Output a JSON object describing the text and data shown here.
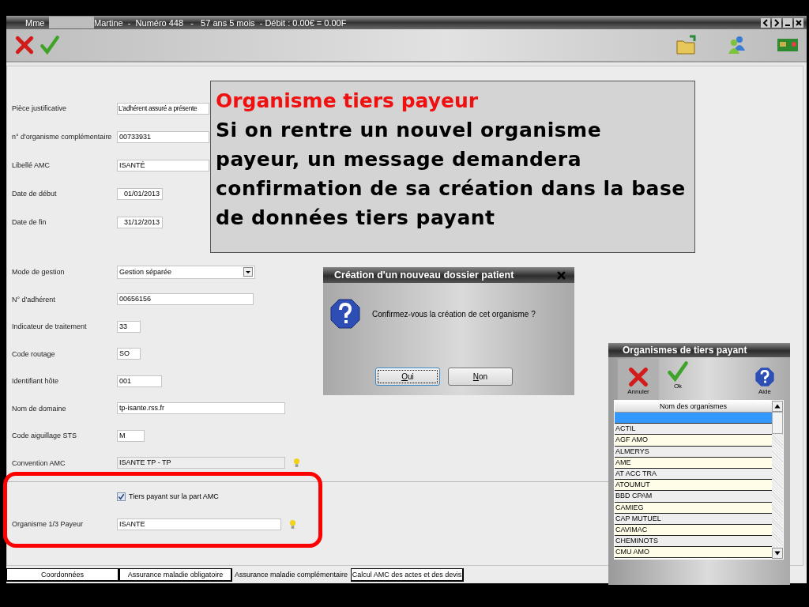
{
  "window": {
    "title_prefix": "Mme",
    "title": "Martine  -  Numéro 448   -   57 ans 5 mois  - Débit : 0.00€ = 0.00F"
  },
  "form": {
    "contract_fields": [
      {
        "label": "Pièce justificative",
        "value": "L'adhérent assuré a présente",
        "kind": "text"
      },
      {
        "label": "n° d'organisme complémentaire",
        "value": "00733931",
        "kind": "text"
      },
      {
        "label": "Libellé AMC",
        "value": "ISANTÉ",
        "kind": "text"
      },
      {
        "label": "Date de début",
        "value": "01/01/2013",
        "kind": "date"
      },
      {
        "label": "Date de fin",
        "value": "31/12/2013",
        "kind": "date"
      }
    ],
    "routing_fields": [
      {
        "label": "Mode de gestion",
        "value": "Gestion séparée",
        "kind": "select"
      },
      {
        "label": "N° d'adhérent",
        "value": "00656156",
        "kind": "text"
      },
      {
        "label": "Indicateur de traitement",
        "value": "33",
        "kind": "text"
      },
      {
        "label": "Code routage",
        "value": "SO",
        "kind": "text"
      },
      {
        "label": "Identifiant hôte",
        "value": "001",
        "kind": "text"
      },
      {
        "label": "Nom de domaine",
        "value": "tp-isante.rss.fr",
        "kind": "text"
      },
      {
        "label": "Code aiguillage STS",
        "value": "M",
        "kind": "text"
      },
      {
        "label": "Convention AMC",
        "value": "ISANTE TP - TP",
        "kind": "lookup"
      }
    ],
    "tiers_payant": {
      "label": "Tiers payant sur la part AMC",
      "checked": true
    },
    "payer_field": {
      "label": "Organisme 1/3 Payeur",
      "value": "ISANTE",
      "kind": "lookup"
    }
  },
  "tabs": [
    {
      "label": "Coordonnées",
      "selected": false
    },
    {
      "label": "Assurance maladie obligatoire",
      "selected": false
    },
    {
      "label": "Assurance maladie complémentaire",
      "selected": true
    },
    {
      "label": "Calcul AMC des actes et des devis",
      "selected": false
    }
  ],
  "callout": {
    "title": "Organisme tiers payeur",
    "body": "Si on rentre un nouvel organisme payeur, un message demandera confirmation de sa création dans la base de données tiers payant"
  },
  "dialog": {
    "title": "Création d'un nouveau dossier patient",
    "message": "Confirmez-vous la création de cet organisme ?",
    "buttons": [
      {
        "label": "Oui",
        "default": true
      },
      {
        "label": "Non",
        "default": false
      }
    ]
  },
  "picker": {
    "title": "Organismes de tiers payant",
    "actions": [
      {
        "label": "Annuler",
        "kind": "cancel",
        "selected": true
      },
      {
        "label": "Ok",
        "kind": "ok",
        "selected": false
      },
      {
        "label": "Aide",
        "kind": "help",
        "selected": false
      }
    ],
    "column": "Nom des organismes",
    "rows": [
      {
        "selected": true
      },
      {
        "name": "ACTIL",
        "selected": false
      },
      {
        "name": "AGF AMO",
        "selected": false
      },
      {
        "name": "ALMERYS",
        "selected": false
      },
      {
        "name": "AME",
        "selected": false
      },
      {
        "name": "AT ACC TRA",
        "selected": false
      },
      {
        "name": "ATOUMUT",
        "selected": false
      },
      {
        "name": "BBD CPAM",
        "selected": false
      },
      {
        "name": "CAMIEG",
        "selected": false
      },
      {
        "name": "CAP MUTUEL",
        "selected": false
      },
      {
        "name": "CAVIMAC",
        "selected": false
      },
      {
        "name": "CHEMINOTS",
        "selected": false
      },
      {
        "name": "CMU AMO",
        "selected": false
      }
    ]
  }
}
